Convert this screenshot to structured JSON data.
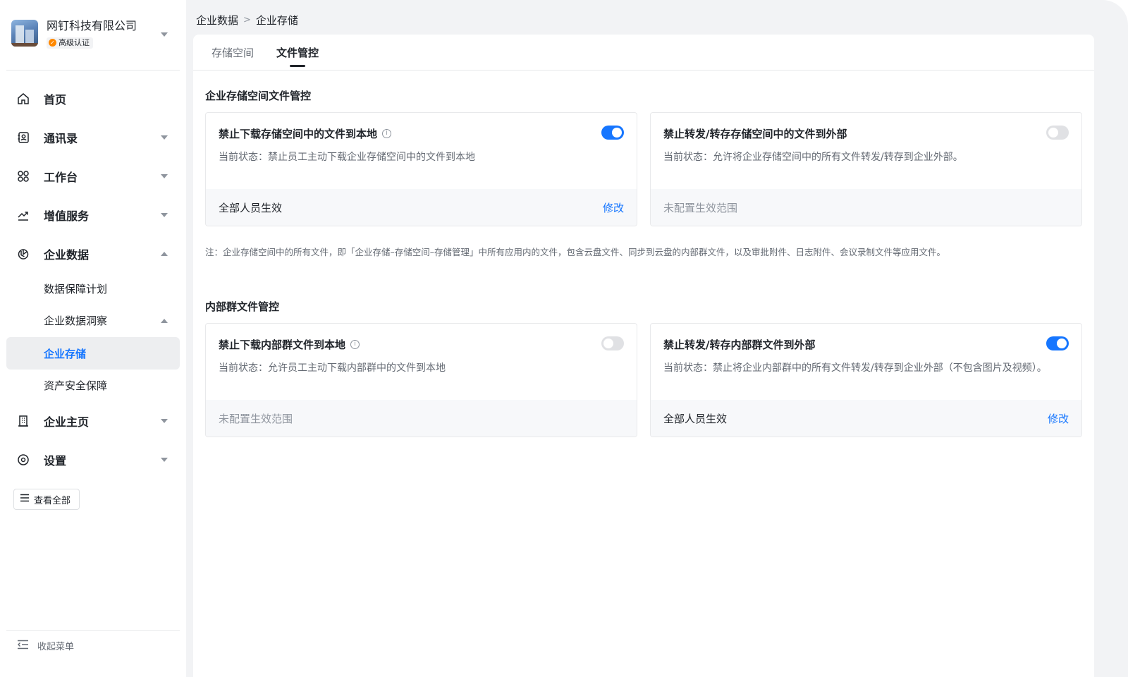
{
  "org": {
    "name": "网钉科技有限公司",
    "badge": "高级认证"
  },
  "nav": {
    "home": "首页",
    "contacts": "通讯录",
    "workbench": "工作台",
    "value_added": "增值服务",
    "enterprise_data": "企业数据",
    "sub": {
      "data_protection": "数据保障计划",
      "data_insight": "企业数据洞察",
      "storage": "企业存储",
      "asset_security": "资产安全保障"
    },
    "homepage": "企业主页",
    "settings": "设置",
    "view_all": "查看全部",
    "collapse": "收起菜单"
  },
  "breadcrumb": {
    "parent": "企业数据",
    "separator": ">",
    "current": "企业存储"
  },
  "tabs": [
    {
      "label": "存储空间",
      "active": false
    },
    {
      "label": "文件管控",
      "active": true
    }
  ],
  "sections": {
    "storage": {
      "title": "企业存储空间文件管控",
      "note": "注：企业存储空间中的所有文件，即「企业存储–存储空间–存储管理」中所有应用内的文件，包含云盘文件、同步到云盘的内部群文件，以及审批附件、日志附件、会议录制文件等应用文件。",
      "cards": [
        {
          "title": "禁止下载存储空间中的文件到本地",
          "desc": "当前状态：禁止员工主动下载企业存储空间中的文件到本地",
          "enabled": true,
          "scope": "全部人员生效",
          "edit": "修改"
        },
        {
          "title": "禁止转发/转存存储空间中的文件到外部",
          "desc": "当前状态：允许将企业存储空间中的所有文件转发/转存到企业外部。",
          "enabled": false,
          "scope": "未配置生效范围"
        }
      ]
    },
    "group": {
      "title": "内部群文件管控",
      "cards": [
        {
          "title": "禁止下载内部群文件到本地",
          "desc": "当前状态：允许员工主动下载内部群中的文件到本地",
          "enabled": false,
          "scope": "未配置生效范围"
        },
        {
          "title": "禁止转发/转存内部群文件到外部",
          "desc": "当前状态：禁止将企业内部群中的所有文件转发/转存到企业外部（不包含图片及视频）。",
          "enabled": true,
          "scope": "全部人员生效",
          "edit": "修改"
        }
      ]
    }
  },
  "colors": {
    "accent": "#1676ff",
    "verified_badge": "#ff8800",
    "toggle_off": "#e0e1e4",
    "page_bg": "#f2f3f5"
  }
}
